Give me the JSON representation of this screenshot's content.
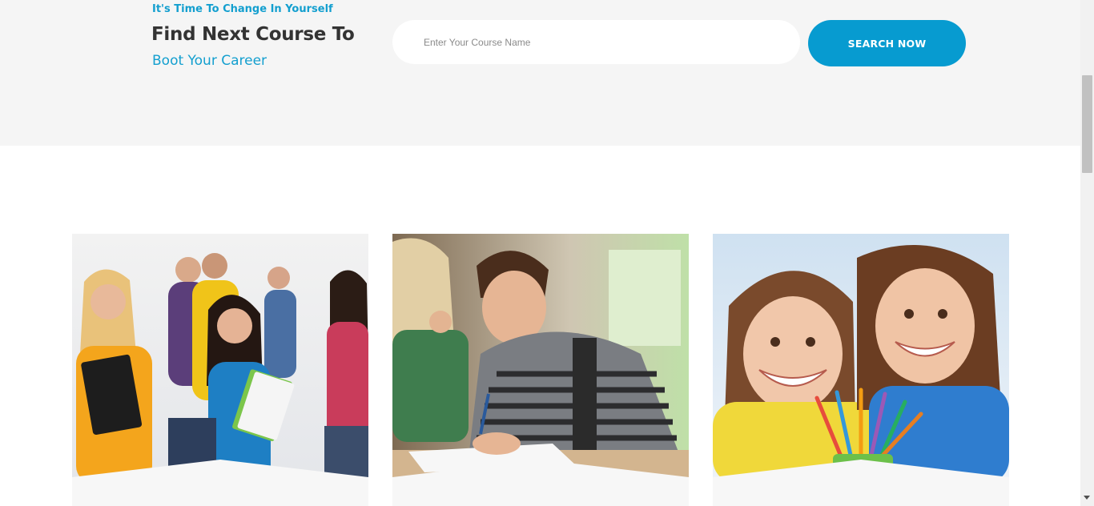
{
  "hero": {
    "tagline": "It's Time To Change In Yourself",
    "headline": "Find Next Course To",
    "subline": "Boot Your Career"
  },
  "search": {
    "placeholder": "Enter Your Course Name",
    "value": "",
    "button_label": "SEARCH NOW"
  },
  "colors": {
    "accent": "#079bd0",
    "heading": "#333333",
    "band": "#f5f5f5"
  },
  "courses": [
    {
      "image": "students-group-with-notebooks-photo"
    },
    {
      "image": "student-writing-exam-photo"
    },
    {
      "image": "smiling-girls-with-pencils-photo"
    }
  ]
}
